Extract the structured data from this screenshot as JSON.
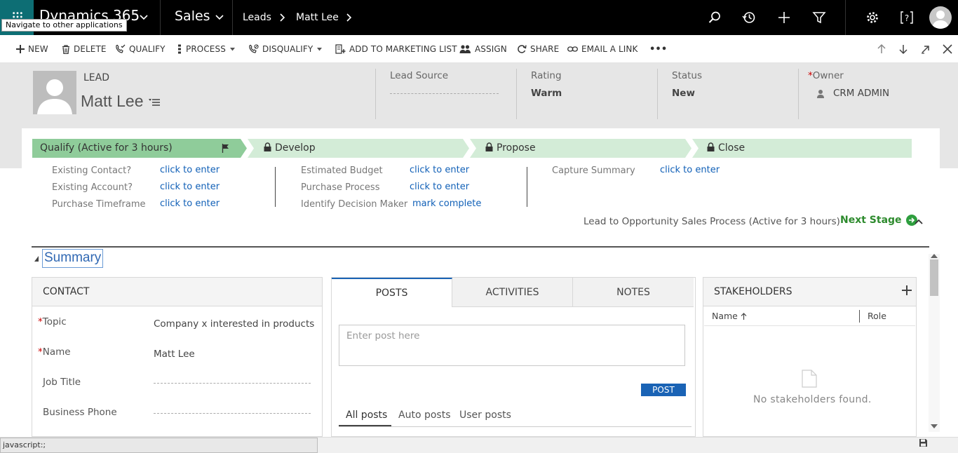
{
  "nav": {
    "brand": "Dynamics 365",
    "app": "Sales",
    "breadcrumb": [
      "Leads",
      "Matt Lee"
    ],
    "tooltip": "Navigate to other applications"
  },
  "commands": {
    "new": "NEW",
    "delete": "DELETE",
    "qualify": "QUALIFY",
    "process": "PROCESS",
    "disqualify": "DISQUALIFY",
    "add_to_marketing_list": "ADD TO MARKETING LIST",
    "assign": "ASSIGN",
    "share": "SHARE",
    "email_link": "EMAIL A LINK",
    "more": "•••"
  },
  "header": {
    "entity": "LEAD",
    "name": "Matt Lee",
    "fields": {
      "lead_source": {
        "label": "Lead Source",
        "value": ""
      },
      "rating": {
        "label": "Rating",
        "value": "Warm"
      },
      "status": {
        "label": "Status",
        "value": "New"
      },
      "owner": {
        "label": "Owner",
        "required": "*",
        "value": "CRM ADMIN"
      }
    }
  },
  "bpf": {
    "stages": [
      {
        "label": "Qualify (Active for 3 hours)",
        "active": true
      },
      {
        "label": "Develop",
        "locked": true
      },
      {
        "label": "Propose",
        "locked": true
      },
      {
        "label": "Close",
        "locked": true
      }
    ],
    "col1": [
      {
        "label": "Existing Contact?",
        "value": "click to enter"
      },
      {
        "label": "Existing Account?",
        "value": "click to enter"
      },
      {
        "label": "Purchase Timeframe",
        "value": "click to enter"
      }
    ],
    "col2": [
      {
        "label": "Estimated Budget",
        "value": "click to enter"
      },
      {
        "label": "Purchase Process",
        "value": "click to enter"
      },
      {
        "label": "Identify Decision Maker",
        "value": "mark complete"
      }
    ],
    "col3": [
      {
        "label": "Capture Summary",
        "value": "click to enter"
      }
    ],
    "process_info": "Lead to Opportunity Sales Process (Active for 3 hours)",
    "next_stage": "Next Stage"
  },
  "summary": {
    "title": "Summary",
    "contact": {
      "heading": "CONTACT",
      "fields": [
        {
          "label": "Topic",
          "required": "*",
          "value": "Company x interested in products"
        },
        {
          "label": "Name",
          "required": "*",
          "value": "Matt Lee"
        },
        {
          "label": "Job Title",
          "value": ""
        },
        {
          "label": "Business Phone",
          "value": ""
        }
      ]
    },
    "social": {
      "tabs": [
        "POSTS",
        "ACTIVITIES",
        "NOTES"
      ],
      "post_placeholder": "Enter post here",
      "post_button": "POST",
      "filters": [
        "All posts",
        "Auto posts",
        "User posts"
      ]
    },
    "stakeholders": {
      "heading": "STAKEHOLDERS",
      "columns": [
        "Name",
        "Role"
      ],
      "empty": "No stakeholders found."
    }
  },
  "statusbar": {
    "url": "javascript:;"
  },
  "colors": {
    "accent": "#1160b7",
    "stage_active": "#8fcc9a",
    "stage_inactive": "#d3ecd7",
    "next_stage": "#2e8b2e"
  }
}
